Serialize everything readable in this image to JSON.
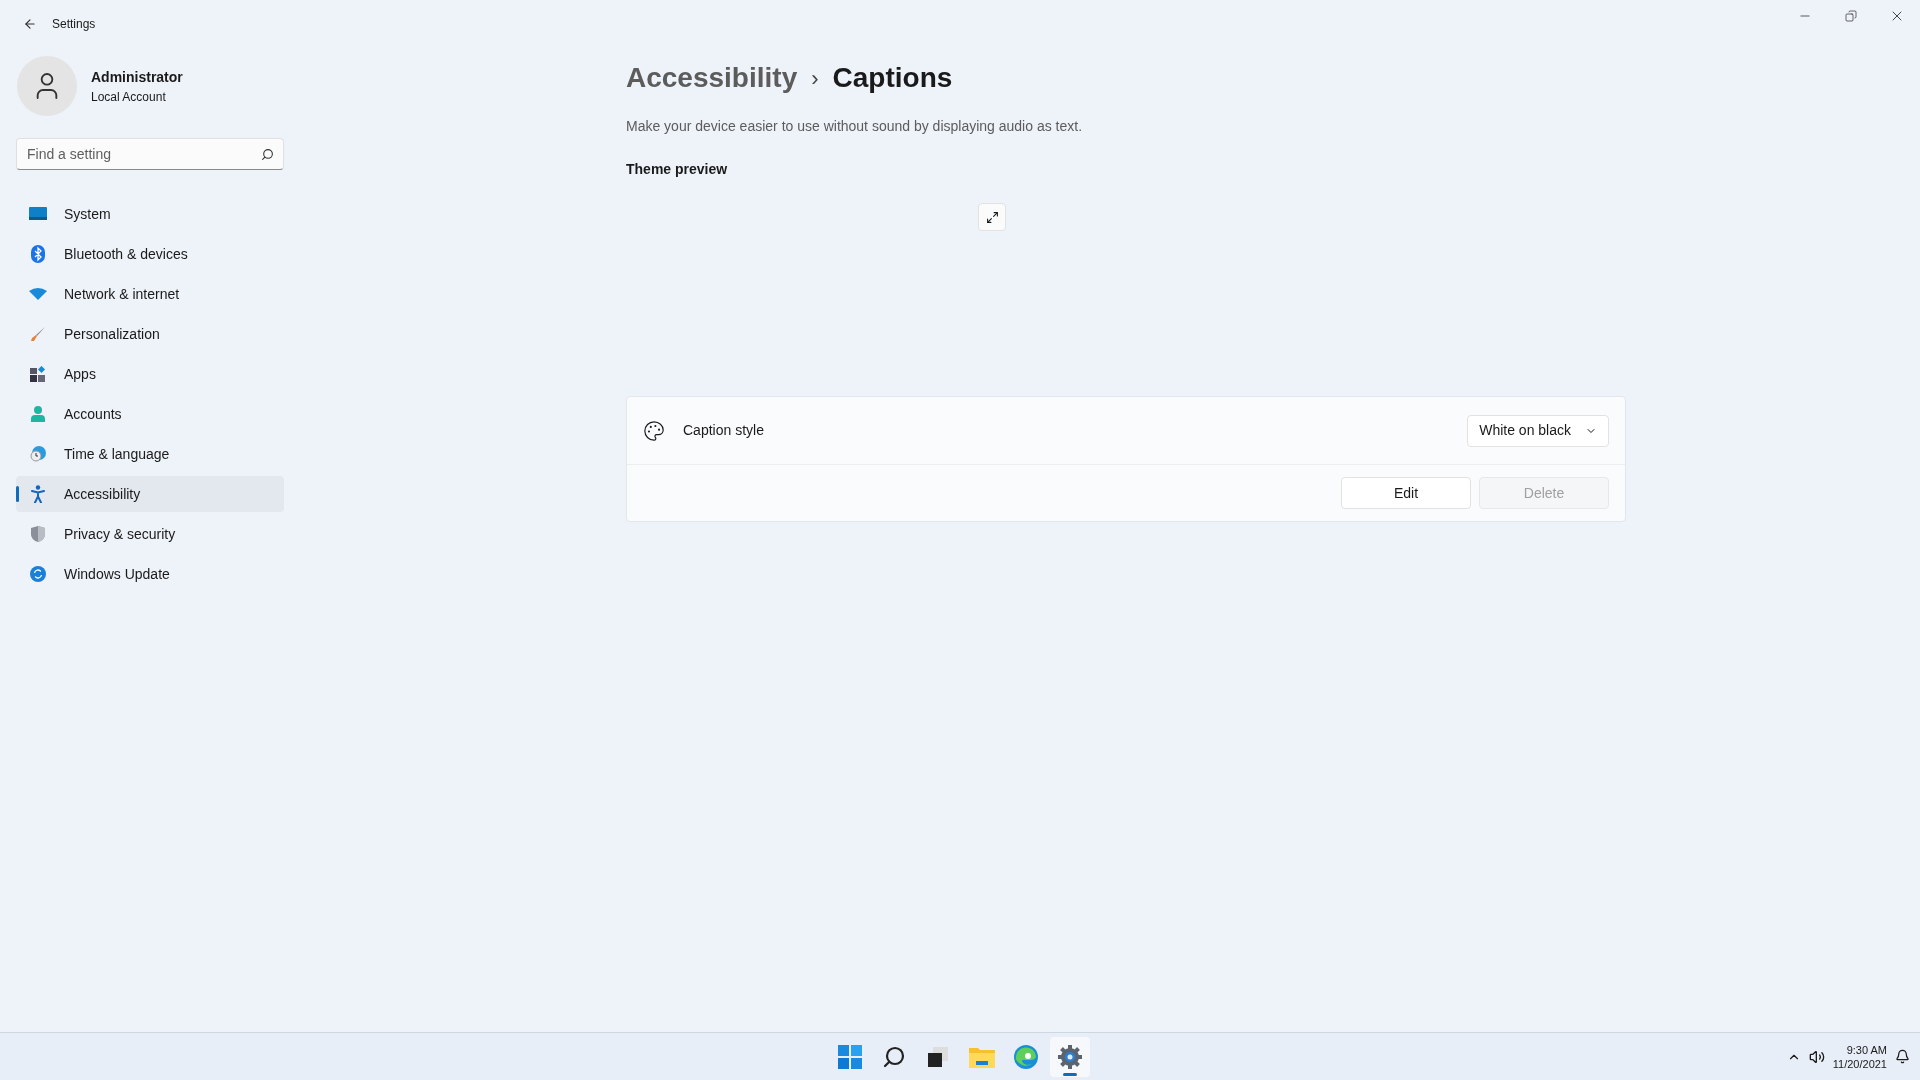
{
  "window": {
    "title": "Settings"
  },
  "user": {
    "name": "Administrator",
    "account": "Local Account"
  },
  "search": {
    "placeholder": "Find a setting"
  },
  "sidebar": {
    "items": [
      {
        "kind": "system",
        "label": "System",
        "selected": false
      },
      {
        "kind": "bluetooth",
        "label": "Bluetooth & devices",
        "selected": false
      },
      {
        "kind": "network",
        "label": "Network & internet",
        "selected": false
      },
      {
        "kind": "personalization",
        "label": "Personalization",
        "selected": false
      },
      {
        "kind": "apps",
        "label": "Apps",
        "selected": false
      },
      {
        "kind": "accounts",
        "label": "Accounts",
        "selected": false
      },
      {
        "kind": "time",
        "label": "Time & language",
        "selected": false
      },
      {
        "kind": "accessibility",
        "label": "Accessibility",
        "selected": true
      },
      {
        "kind": "privacy",
        "label": "Privacy & security",
        "selected": false
      },
      {
        "kind": "update",
        "label": "Windows Update",
        "selected": false
      }
    ]
  },
  "breadcrumb": {
    "parent": "Accessibility",
    "separator": "›",
    "current": "Captions"
  },
  "description": "Make your device easier to use without sound by displaying audio as text.",
  "theme_preview": {
    "heading": "Theme preview"
  },
  "caption_style": {
    "label": "Caption style",
    "value": "White on black",
    "buttons": [
      {
        "label": "Edit",
        "disabled": false
      },
      {
        "label": "Delete",
        "disabled": true
      }
    ]
  },
  "taskbar": {
    "apps": [
      {
        "kind": "start",
        "selected": false
      },
      {
        "kind": "search",
        "selected": false
      },
      {
        "kind": "taskview",
        "selected": false
      },
      {
        "kind": "explorer",
        "selected": false
      },
      {
        "kind": "edge",
        "selected": false
      },
      {
        "kind": "settings",
        "selected": true
      }
    ],
    "time": "9:30 AM",
    "date": "11/20/2021"
  }
}
